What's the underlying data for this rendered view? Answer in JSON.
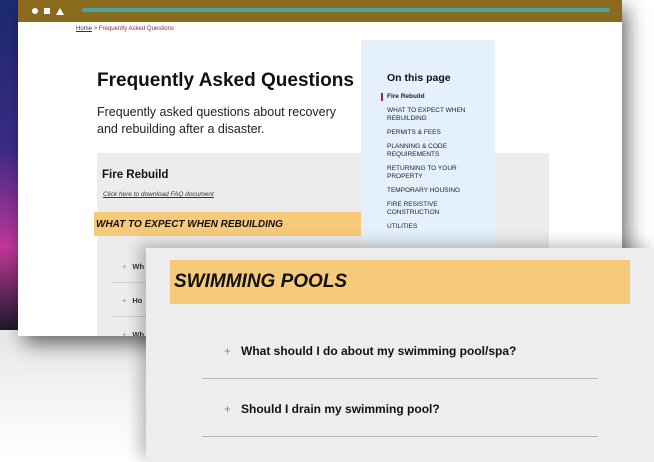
{
  "breadcrumb": {
    "home": "Home",
    "separator": ">",
    "current": "Frequently Asked Questions"
  },
  "page": {
    "title": "Frequently Asked Questions",
    "subtitle": "Frequently asked questions about recovery and rebuilding after a disaster."
  },
  "section": {
    "title": "Fire Rebuild",
    "download_link": "Click here to download FAQ document",
    "highlight": "WHAT TO EXPECT WHEN REBUILDING",
    "faq_rows": [
      "Wh",
      "Ho",
      "Wh"
    ]
  },
  "toc": {
    "title": "On this page",
    "items": [
      "Fire Rebuild",
      "WHAT TO EXPECT WHEN REBUILDING",
      "PERMITS & FEES",
      "PLANNING & CODE REQUIREMENTS",
      "RETURNING TO YOUR PROPERTY",
      "TEMPORARY HOUSING",
      "FIRE RESISTIVE CONSTRUCTION",
      "UTILITIES"
    ]
  },
  "zoom": {
    "header": "SWIMMING POOLS",
    "questions": [
      "What should I do about my swimming pool/spa?",
      "Should I drain my swimming pool?"
    ],
    "plus_symbol": "+"
  },
  "colors": {
    "titlebar": "#8a6a1c",
    "highlight": "#f7c97a",
    "toc_background": "#e4f0fb",
    "accent": "#b0195a"
  }
}
